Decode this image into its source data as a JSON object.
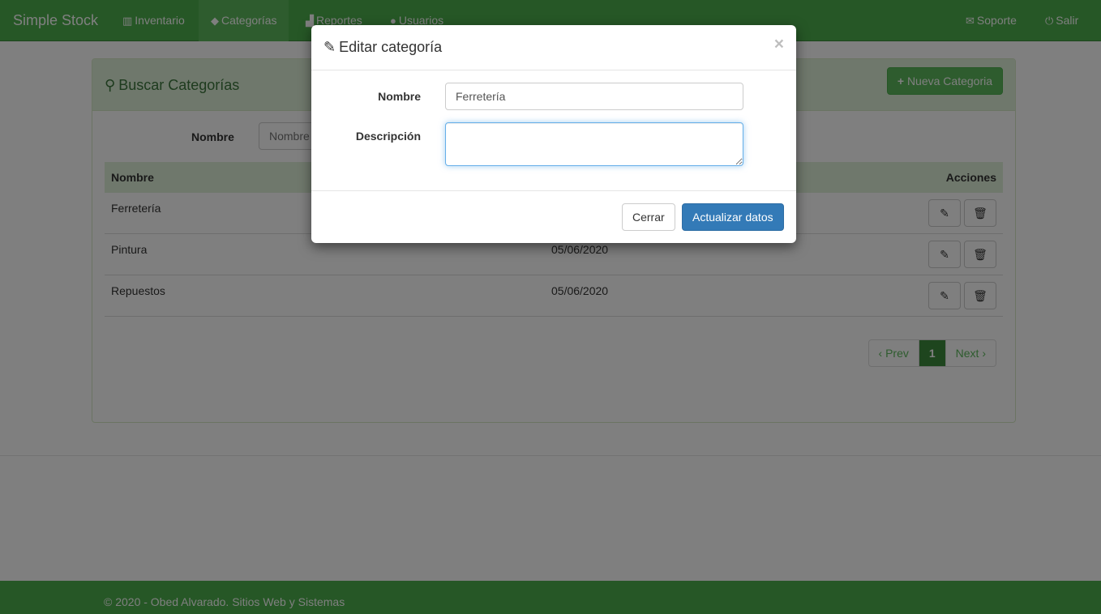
{
  "navbar": {
    "brand": "Simple Stock",
    "items": [
      {
        "label": "Inventario",
        "icon": "barcode-icon",
        "glyph": "▥"
      },
      {
        "label": "Categorías",
        "icon": "tags-icon",
        "glyph": "◆"
      },
      {
        "label": "Reportes",
        "icon": "signal-icon",
        "glyph": "▟"
      },
      {
        "label": "Usuarios",
        "icon": "user-icon",
        "glyph": "●"
      },
      {
        "label": "Soporte",
        "icon": "envelope-icon",
        "glyph": "✉"
      },
      {
        "label": "Salir",
        "icon": "power-icon",
        "glyph": "⏻"
      }
    ],
    "active": "Categorías"
  },
  "panel": {
    "title": "Buscar Categorías",
    "new_button": "Nueva Categoria",
    "search_label": "Nombre",
    "search_placeholder": "Nombre"
  },
  "table": {
    "headers": {
      "name": "Nombre",
      "actions": "Acciones"
    },
    "rows": [
      {
        "name": "Ferretería",
        "date": ""
      },
      {
        "name": "Pintura",
        "date": "05/06/2020"
      },
      {
        "name": "Repuestos",
        "date": "05/06/2020"
      }
    ]
  },
  "pagination": {
    "prev": "‹ Prev",
    "current": "1",
    "next": "Next ›"
  },
  "footer": {
    "text": "© 2020 - Obed Alvarado. Sitios Web y Sistemas"
  },
  "modal": {
    "title": "Editar categoría",
    "close_glyph": "×",
    "fields": {
      "name_label": "Nombre",
      "name_value": "Ferretería",
      "description_label": "Descripción",
      "description_value": ""
    },
    "buttons": {
      "close": "Cerrar",
      "update": "Actualizar datos"
    }
  },
  "colors": {
    "brand_green": "#5cb85c",
    "primary_blue": "#337ab7"
  }
}
